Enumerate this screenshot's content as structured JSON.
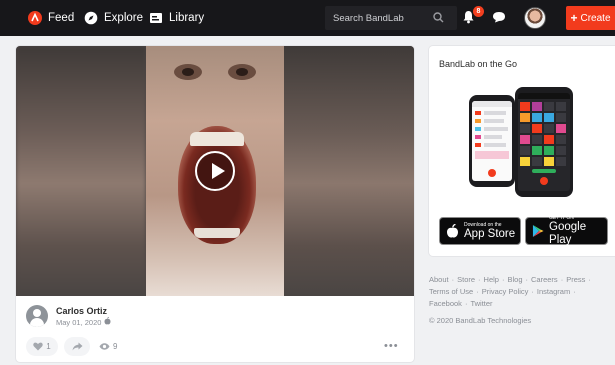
{
  "nav": {
    "feed_label": "Feed",
    "explore_label": "Explore",
    "library_label": "Library",
    "search_placeholder": "Search BandLab",
    "notification_count": "8",
    "create_label": "Create"
  },
  "post": {
    "author": "Carlos Ortiz",
    "date": "May 01, 2020",
    "likes": "1",
    "views": "9",
    "more_label": "•••"
  },
  "sidebar": {
    "promo_title": "BandLab on the Go",
    "app_store": {
      "small": "Download on the",
      "big": "App Store"
    },
    "google_play": {
      "small": "GET IT ON",
      "big": "Google Play"
    },
    "footer_links": [
      "About",
      "Store",
      "Help",
      "Blog",
      "Careers",
      "Press",
      "Terms of Use",
      "Privacy Policy",
      "Instagram",
      "Facebook",
      "Twitter"
    ],
    "copyright": "© 2020 BandLab Technologies"
  },
  "colors": {
    "accent": "#f23b1d",
    "topbar": "#17171a",
    "page_bg": "#f0f1f3",
    "muted_text": "#8b8f96"
  },
  "icons": [
    "bandlab-logo-icon",
    "explore-compass-icon",
    "library-icon",
    "search-icon",
    "bell-icon",
    "chat-icon",
    "plus-icon",
    "play-icon",
    "apple-icon",
    "heart-icon",
    "share-icon",
    "eye-icon",
    "google-play-icon"
  ]
}
